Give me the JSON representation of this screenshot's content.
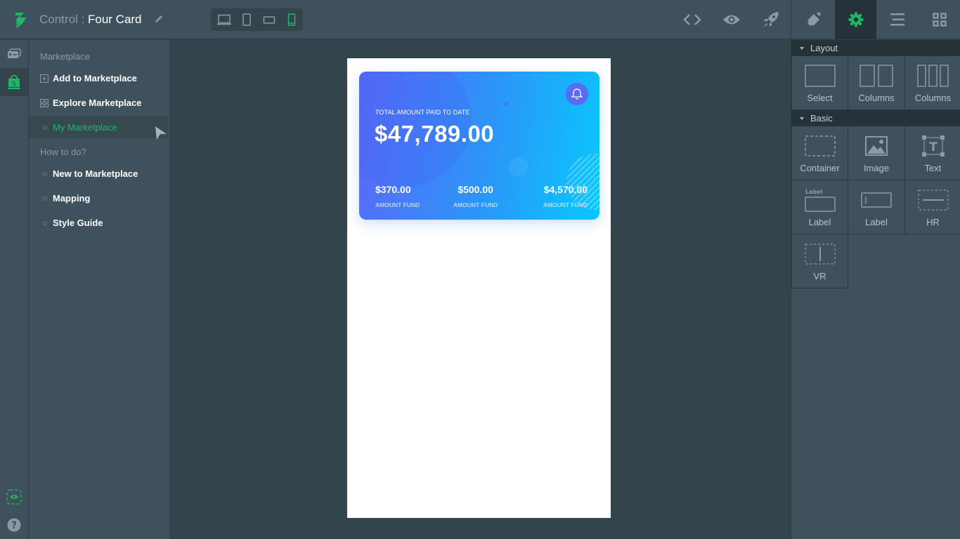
{
  "app": {
    "title_prefix": "Control : ",
    "title_name": "Four Card",
    "accent_color": "#22b566"
  },
  "toolbar": {
    "devices": [
      {
        "name": "desktop",
        "active": false
      },
      {
        "name": "tablet",
        "active": false
      },
      {
        "name": "tablet-landscape",
        "active": false
      },
      {
        "name": "mobile",
        "active": true
      }
    ],
    "actions": [
      "code-icon",
      "preview-eye-icon",
      "publish-rocket-icon"
    ],
    "right_tabs": [
      {
        "name": "style-brush-icon",
        "active": false
      },
      {
        "name": "settings-gear-icon",
        "active": true
      },
      {
        "name": "layers-menu-icon",
        "active": false
      },
      {
        "name": "components-grid-icon",
        "active": false
      }
    ]
  },
  "rail": {
    "items": [
      {
        "name": "cards-icon",
        "active": false
      },
      {
        "name": "marketplace-bag-icon",
        "active": true
      }
    ],
    "bottom": [
      "visibility-eye-icon",
      "help-icon"
    ]
  },
  "nav": {
    "section1": "Marketplace",
    "items1": [
      {
        "label": "Add to Marketplace",
        "icon": "plus-square-icon"
      },
      {
        "label": "Explore Marketplace",
        "icon": "grid-icon"
      },
      {
        "label": "My Marketplace",
        "icon": "bullet",
        "active": true
      }
    ],
    "section2": "How to do?",
    "items2": [
      {
        "label": "New to Marketplace"
      },
      {
        "label": "Mapping"
      },
      {
        "label": "Style Guide"
      }
    ]
  },
  "card": {
    "label": "TOTAL AMOUNT PAID TO DATE",
    "total": "$47,789.00",
    "funds": [
      {
        "amount": "$370.00",
        "label": "AMOUNT FUND"
      },
      {
        "amount": "$500.00",
        "label": "AMOUNT FUND"
      },
      {
        "amount": "$4,570.00",
        "label": "AMOUNT FUND"
      }
    ],
    "gradient_start": "#5c67f8",
    "gradient_end": "#08c8fe"
  },
  "panel": {
    "groups": [
      {
        "title": "Layout",
        "items": [
          "Select",
          "Columns",
          "Columns"
        ]
      },
      {
        "title": "Basic",
        "items": [
          "Container",
          "Image",
          "Text",
          "Label",
          "Label",
          "HR",
          "VR"
        ]
      }
    ],
    "label_icon_text": "Label"
  }
}
